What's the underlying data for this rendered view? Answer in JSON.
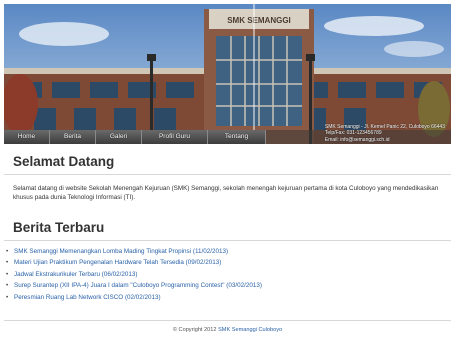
{
  "banner": {
    "sign_text": "SMK SEMANGGI",
    "nav": [
      {
        "label": "Home",
        "name": "nav-home"
      },
      {
        "label": "Berita",
        "name": "nav-berita"
      },
      {
        "label": "Galeri",
        "name": "nav-galeri"
      },
      {
        "label": "Profil Guru",
        "name": "nav-profil-guru"
      },
      {
        "label": "Tentang",
        "name": "nav-tentang"
      }
    ],
    "contact": {
      "address": "SMK Semanggi - Jl. Kernel Panic 22, Culoboyo 66443",
      "phone": "Telp/Fax: 031-123456789",
      "email": "Email: info@semanggi.sch.id"
    }
  },
  "welcome": {
    "title": "Selamat Datang",
    "text": "Selamat datang di website Sekolah Menengah Kejuruan (SMK) Semanggi, sekolah menengah kejuruan pertama di kota Culoboyo yang mendedikasikan khusus pada dunia Teknologi Informasi (TI)."
  },
  "news": {
    "title": "Berita Terbaru",
    "bullet": "•",
    "items": [
      "SMK Semanggi Memenangkan Lomba Mading Tingkat Propinsi (11/02/2013)",
      "Materi Ujian Praktikum Pengenalan Hardware Telah Tersedia (09/02/2013)",
      "Jadwal Ekstrakurikuler Terbaru (06/02/2013)",
      "Surep Surantep (XII IPA-4) Juara I dalam \"Culoboyo Programming Contest\" (03/02/2013)",
      "Peresmian Ruang Lab Network CISCO (02/02/2013)"
    ]
  },
  "footer": {
    "copyright": "© Copyright 2012",
    "link": "SMK Semanggi Culoboyo"
  }
}
